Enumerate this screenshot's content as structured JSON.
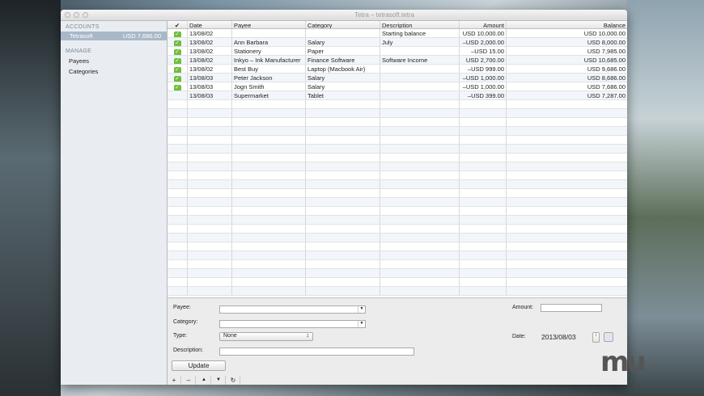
{
  "window": {
    "title": "Tetra – tetrasoft.tetra"
  },
  "sidebar": {
    "accounts_header": "ACCOUNTS",
    "account": {
      "name": "Tetrasoft",
      "balance": "USD 7,686.00"
    },
    "manage_header": "MANAGE",
    "items": [
      {
        "label": "Payees"
      },
      {
        "label": "Categories"
      }
    ]
  },
  "table": {
    "headers": [
      "✔",
      "Date",
      "Payee",
      "Category",
      "Description",
      "Amount",
      "Balance"
    ],
    "rows": [
      {
        "checked": true,
        "date": "13/08/02",
        "payee": "",
        "category": "",
        "description": "Starting balance",
        "amount": "USD 10,000.00",
        "balance": "USD 10,000.00"
      },
      {
        "checked": true,
        "date": "13/08/02",
        "payee": "Ann Barbara",
        "category": "Salary",
        "description": "July",
        "amount": "–USD 2,000.00",
        "balance": "USD 8,000.00"
      },
      {
        "checked": true,
        "date": "13/08/02",
        "payee": "Stationery",
        "category": "Paper",
        "description": "",
        "amount": "–USD 15.00",
        "balance": "USD 7,985.00"
      },
      {
        "checked": true,
        "date": "13/08/02",
        "payee": "Inkyo – Ink Manufacturer",
        "category": "Finance Software",
        "description": "Software Income",
        "amount": "USD 2,700.00",
        "balance": "USD 10,685.00"
      },
      {
        "checked": true,
        "date": "13/08/02",
        "payee": "Best Buy",
        "category": "Laptop (Macbook Air)",
        "description": "",
        "amount": "–USD 999.00",
        "balance": "USD 9,686.00"
      },
      {
        "checked": true,
        "date": "13/08/03",
        "payee": "Peter Jackson",
        "category": "Salary",
        "description": "",
        "amount": "–USD 1,000.00",
        "balance": "USD 8,686.00"
      },
      {
        "checked": true,
        "date": "13/08/03",
        "payee": "Jogn Smith",
        "category": "Salary",
        "description": "",
        "amount": "–USD 1,000.00",
        "balance": "USD 7,686.00"
      },
      {
        "checked": false,
        "date": "13/08/03",
        "payee": "Supermarket",
        "category": "Tablet",
        "description": "",
        "amount": "–USD 399.00",
        "balance": "USD 7,287.00"
      }
    ]
  },
  "form": {
    "payee_label": "Payee:",
    "category_label": "Category:",
    "type_label": "Type:",
    "type_value": "None",
    "description_label": "Description:",
    "amount_label": "Amount:",
    "date_label": "Date:",
    "date_value": "2013/08/03",
    "update_label": "Update"
  },
  "toolbar": {
    "add": "+",
    "remove": "–",
    "up": "▲",
    "down": "▼",
    "refresh": "↻"
  },
  "watermark": "mu"
}
